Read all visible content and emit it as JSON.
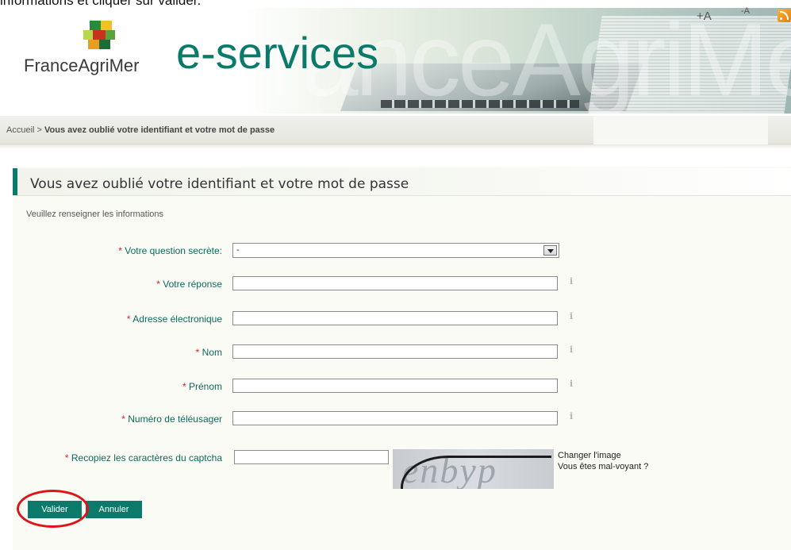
{
  "caption": "informations et cliquer sur valider.",
  "header": {
    "brand": "FranceAgriMer",
    "service": "e-services",
    "ghost_text": "ranceAgriMer"
  },
  "breadcrumb": {
    "home": "Accueil",
    "separator": " > ",
    "current": "Vous avez oublié votre identifiant et votre mot de passe"
  },
  "tools": {
    "increase_font": "+A",
    "decrease_font": "-A",
    "rss_icon": "rss-icon"
  },
  "form": {
    "title": "Vous avez oublié votre identifiant et votre mot de passe",
    "instructions": "Veuillez renseigner les informations",
    "required_mark": "*",
    "fields": {
      "secret_question": {
        "label": "Votre question secrète:",
        "value": "-"
      },
      "answer": {
        "label": "Votre réponse",
        "value": ""
      },
      "email": {
        "label": "Adresse électronique",
        "value": ""
      },
      "last_name": {
        "label": "Nom",
        "value": ""
      },
      "first_name": {
        "label": "Prénom",
        "value": ""
      },
      "user_number": {
        "label": "Numéro de téléusager",
        "value": ""
      },
      "captcha": {
        "label": "Recopiez les caractères du captcha",
        "value": ""
      }
    },
    "info_glyph": "i",
    "captcha_image_text": "enbyp",
    "captcha_change": "Changer l'image",
    "captcha_accessible": "Vous êtes mal-voyant ?",
    "submit": "Valider",
    "cancel": "Annuler"
  },
  "colors": {
    "accent": "#0b7a6a",
    "required": "#dd2222",
    "highlight_circle": "#e0131b"
  }
}
